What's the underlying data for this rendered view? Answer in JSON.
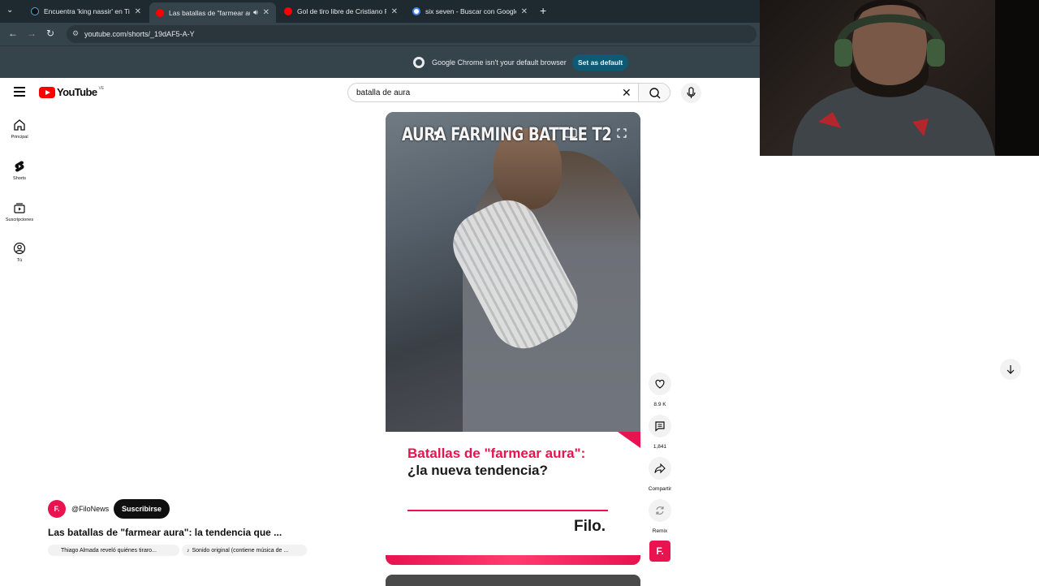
{
  "browser": {
    "tabs": [
      {
        "title": "Encuentra 'king nassir' en TikTok",
        "active": false,
        "favicon_color": "#111111"
      },
      {
        "title": "Las batallas de \"farmear au",
        "active": true,
        "favicon_color": "#ff0000"
      },
      {
        "title": "Gol de tiro libre de Cristiano Ro",
        "active": false,
        "favicon_color": "#ff0000"
      },
      {
        "title": "six seven - Buscar con Google",
        "active": false,
        "favicon_color": "#ffffff"
      }
    ],
    "url": "youtube.com/shorts/_19dAF5-A-Y",
    "infobar_message": "Google Chrome isn't your default browser",
    "set_default_label": "Set as default"
  },
  "youtube": {
    "logo_text": "YouTube",
    "country_code": "VE",
    "search_value": "batalla de aura",
    "rail": [
      {
        "label": "Principal",
        "icon": "home-icon"
      },
      {
        "label": "Shorts",
        "icon": "shorts-icon"
      },
      {
        "label": "Suscripciones",
        "icon": "subscriptions-icon"
      },
      {
        "label": "Tú",
        "icon": "you-icon"
      }
    ]
  },
  "short": {
    "overlay_text": "AURA FARMING BATTLE T2",
    "card_headline_pink": "Batallas de \"farmear aura\":",
    "card_headline_dark": " ¿la nueva tendencia?",
    "card_brand": "Filo.",
    "actions": {
      "likes": "8.9 K",
      "comments": "1,841",
      "share": "Compartir",
      "remix": "Remix"
    },
    "channel_badge": "F.",
    "channel_handle": "@FiloNews",
    "subscribe_label": "Suscribirse",
    "title": "Las batallas de \"farmear aura\": la tendencia que ...",
    "chips": [
      "Thiago Almada reveló quiénes tiraro...",
      "Sonido original (contiene música de ..."
    ]
  },
  "colors": {
    "accent_pink": "#e8134f",
    "youtube_red": "#ff0000",
    "chrome_dark": "#35434a"
  }
}
